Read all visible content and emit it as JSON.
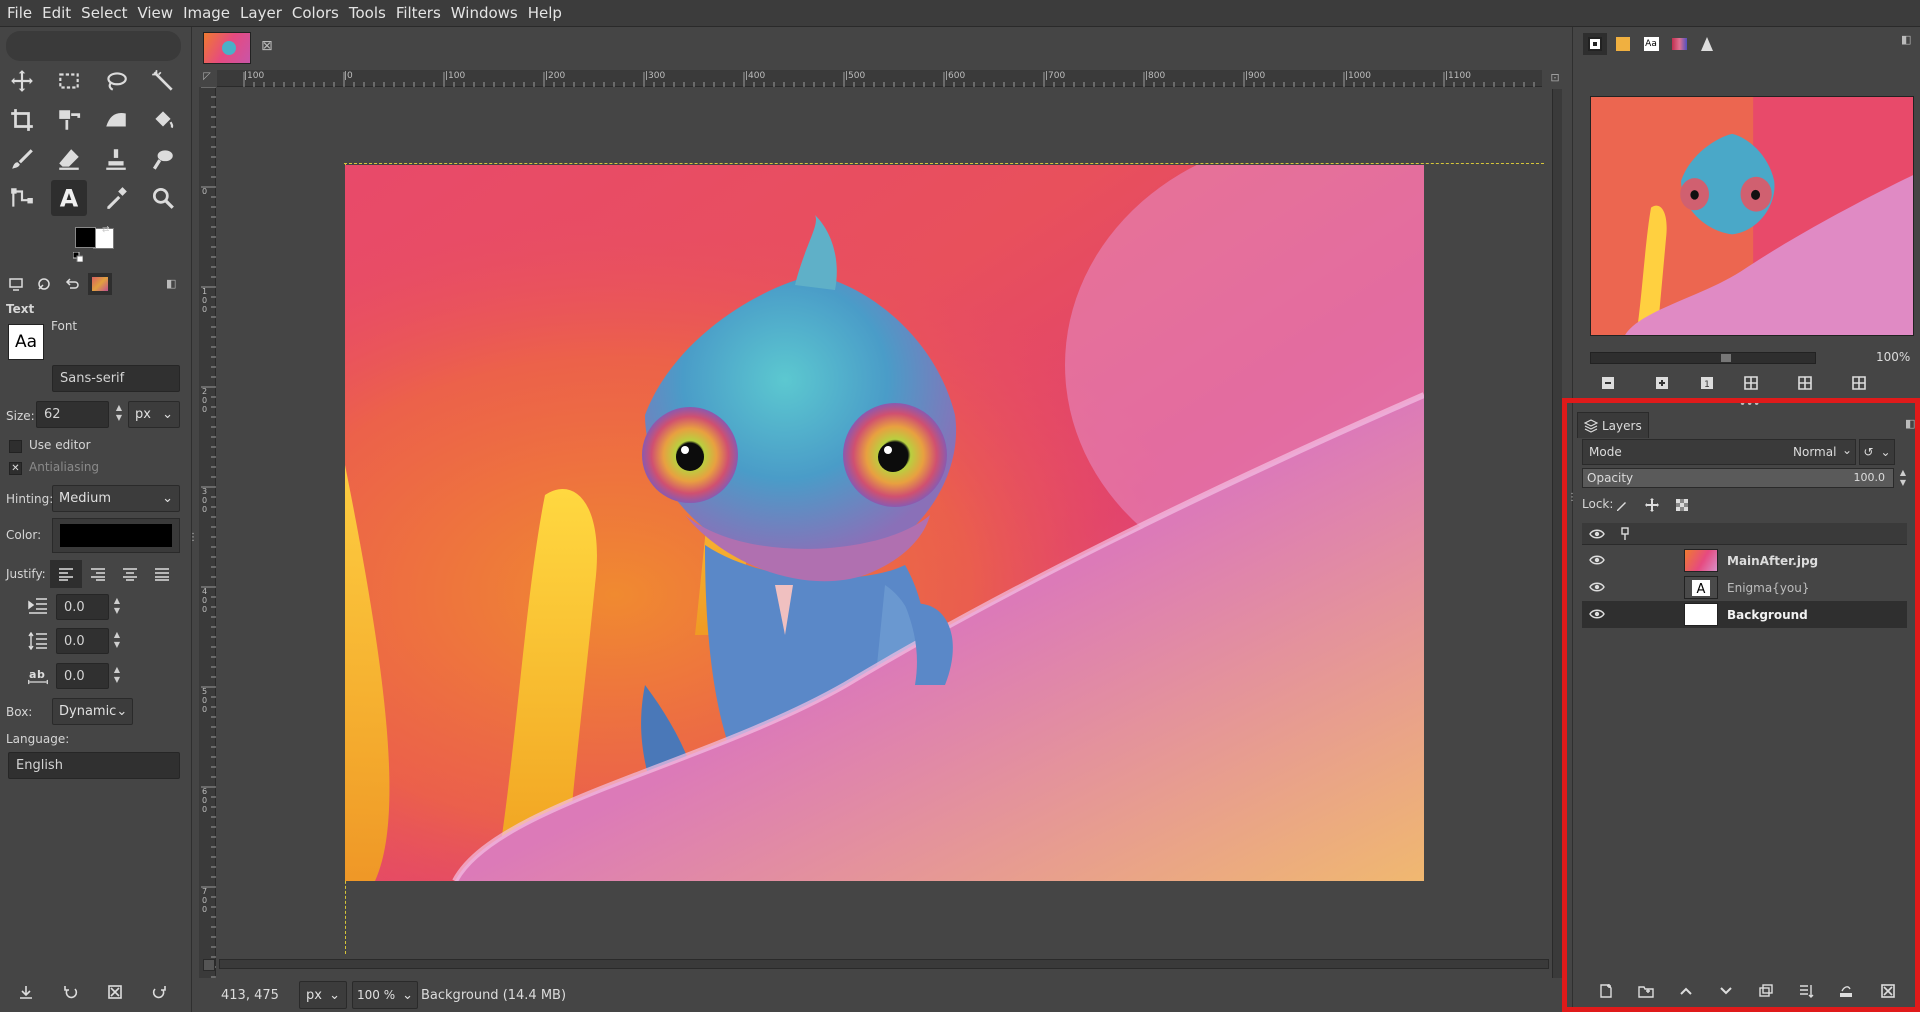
{
  "menubar": {
    "items": [
      "File",
      "Edit",
      "Select",
      "View",
      "Image",
      "Layer",
      "Colors",
      "Tools",
      "Filters",
      "Windows",
      "Help"
    ]
  },
  "tool_options": {
    "title": "Text",
    "font_label": "Font",
    "font_value": "Sans-serif",
    "font_preview": "Aa",
    "size_label": "Size:",
    "size_value": "62",
    "size_unit": "px",
    "use_editor_label": "Use editor",
    "antialiasing_label": "Antialiasing",
    "hinting_label": "Hinting:",
    "hinting_value": "Medium",
    "color_label": "Color:",
    "justify_label": "Justify:",
    "indent_value": "0.0",
    "line_spacing_value": "0.0",
    "letter_spacing_value": "0.0",
    "box_label": "Box:",
    "box_value": "Dynamic",
    "language_label": "Language:",
    "language_value": "English"
  },
  "canvas": {
    "ruler_labels": [
      "|100",
      "|0",
      "|100",
      "|200",
      "|300",
      "|400",
      "|500",
      "|600",
      "|700",
      "|800",
      "|900",
      "|1000",
      "|1100"
    ],
    "vruler_labels": [
      "0",
      "1 0 0",
      "2 0 0",
      "3 0 0",
      "4 0 0",
      "5 0 0",
      "6 0 0",
      "7 0 0"
    ]
  },
  "status": {
    "coords": "413, 475",
    "unit": "px",
    "zoom": "100 %",
    "info": "Background (14.4 MB)"
  },
  "navigator": {
    "zoom": "100%"
  },
  "layers": {
    "tab_label": "Layers",
    "mode_label": "Mode",
    "mode_value": "Normal",
    "opacity_label": "Opacity",
    "opacity_value": "100.0",
    "lock_label": "Lock:",
    "items": [
      {
        "name": "MainAfter.jpg",
        "visible": true,
        "bold": true
      },
      {
        "name": "Enigma{you}",
        "visible": true,
        "bold": false
      },
      {
        "name": "Background",
        "visible": true,
        "bold": true
      }
    ]
  },
  "colors": {
    "highlight_box": "#e01a1a",
    "fg": "#000000",
    "bg": "#ffffff"
  }
}
